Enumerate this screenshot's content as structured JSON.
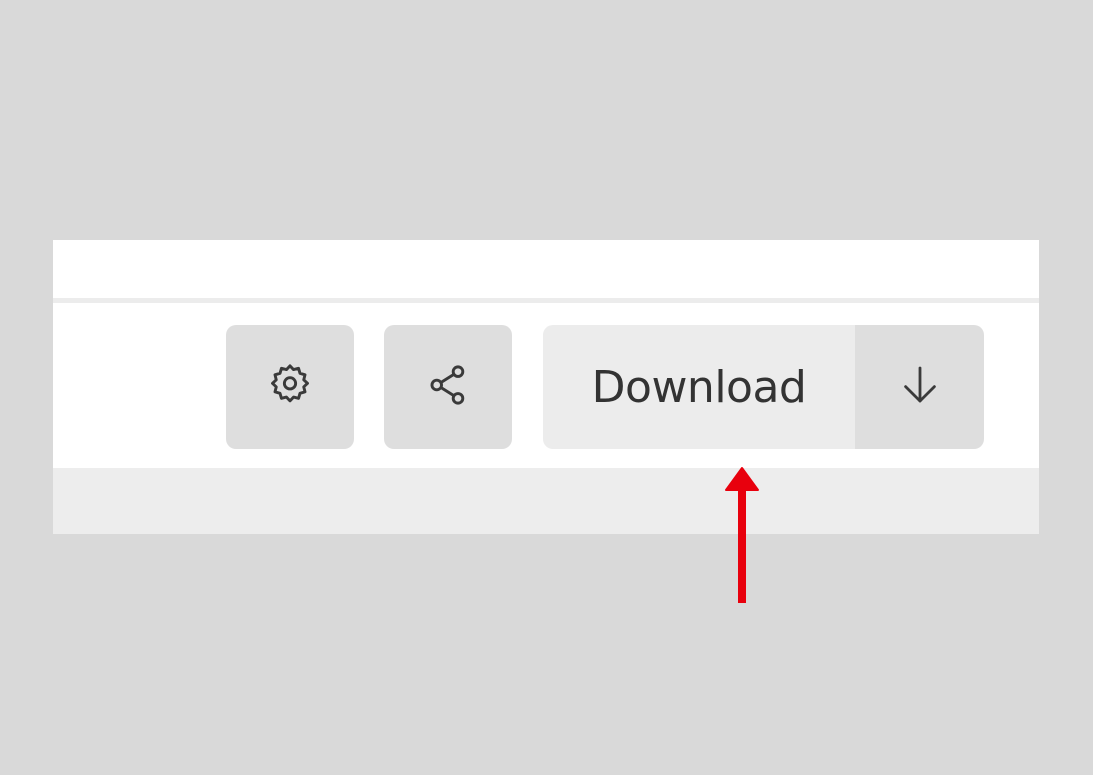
{
  "toolbar": {
    "settings_icon": "gear-icon",
    "share_icon": "share-icon",
    "download_label": "Download",
    "download_arrow_icon": "arrow-down-icon"
  },
  "annotation": {
    "icon": "red-arrow-up-icon",
    "color": "#e8000d"
  },
  "colors": {
    "background": "#d9d9d9",
    "panel": "#ffffff",
    "button": "#dedede",
    "download_main": "#ececec",
    "text": "#333333"
  }
}
